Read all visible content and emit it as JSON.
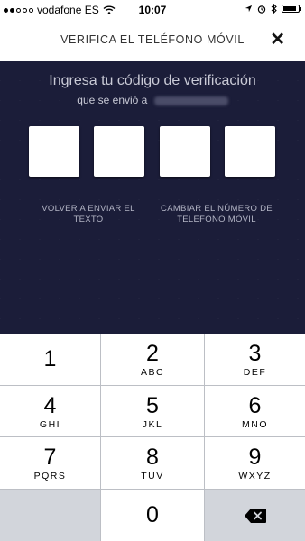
{
  "status_bar": {
    "carrier": "vodafone ES",
    "time": "10:07",
    "signal_bars_filled": 2,
    "signal_bars_total": 5,
    "battery_level": 0.85,
    "icons": [
      "wifi-icon",
      "location-arrow-icon",
      "alarm-icon",
      "bluetooth-icon",
      "battery-icon"
    ]
  },
  "header": {
    "title": "VERIFICA EL TELÉFONO MÓVIL",
    "close_icon": "close-icon",
    "close_glyph": "✕"
  },
  "verification": {
    "heading": "Ingresa tu código de verificación",
    "sent_to_label": "que se envió a",
    "code_digits": [
      "",
      "",
      "",
      ""
    ]
  },
  "links": {
    "resend": "VOLVER A ENVIAR EL TEXTO",
    "change_number": "CAMBIAR EL NÚMERO DE TELÉFONO MÓVIL"
  },
  "keypad": {
    "keys": [
      {
        "num": "1",
        "letters": ""
      },
      {
        "num": "2",
        "letters": "ABC"
      },
      {
        "num": "3",
        "letters": "DEF"
      },
      {
        "num": "4",
        "letters": "GHI"
      },
      {
        "num": "5",
        "letters": "JKL"
      },
      {
        "num": "6",
        "letters": "MNO"
      },
      {
        "num": "7",
        "letters": "PQRS"
      },
      {
        "num": "8",
        "letters": "TUV"
      },
      {
        "num": "9",
        "letters": "WXYZ"
      },
      {
        "num": "0",
        "letters": ""
      }
    ],
    "backspace_icon": "backspace-icon"
  },
  "colors": {
    "panel_bg": "#1b1d39",
    "panel_text": "#c9cad6",
    "keypad_bg": "#bcbfc5",
    "key_gray": "#d2d5db"
  }
}
